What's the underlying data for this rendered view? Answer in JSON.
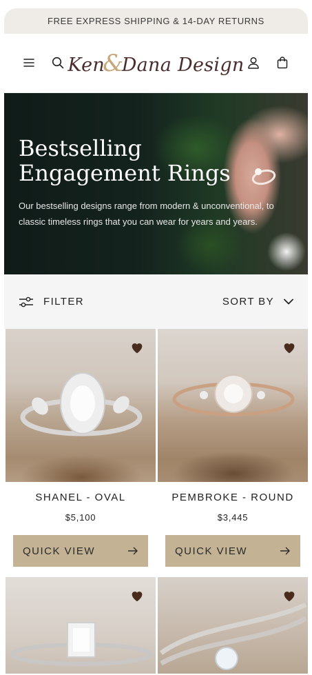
{
  "promo": {
    "text": "FREE EXPRESS SHIPPING & 14-DAY RETURNS"
  },
  "header": {
    "logo_part1": "Ken",
    "logo_amp": "&",
    "logo_part2": "Dana Design",
    "icons": [
      "menu-icon",
      "search-icon",
      "account-icon",
      "bag-icon"
    ]
  },
  "hero": {
    "title_line1": "Bestselling",
    "title_line2": "Engagement Rings",
    "description": "Our bestselling designs range from modern & unconventional, to classic timeless rings that you can wear for years and years."
  },
  "toolbar": {
    "filter_label": "FILTER",
    "sort_label": "SORT BY"
  },
  "products": [
    {
      "name": "SHANEL - OVAL",
      "price": "$5,100",
      "cta": "QUICK VIEW"
    },
    {
      "name": "PEMBROKE - ROUND",
      "price": "$3,445",
      "cta": "QUICK VIEW"
    },
    {
      "name": "",
      "price": "",
      "cta": ""
    },
    {
      "name": "",
      "price": "",
      "cta": ""
    }
  ],
  "colors": {
    "promo_bg": "#efebe6",
    "accent": "#c3b293",
    "heart": "#4a2c1e",
    "logo": "#4a2c2c",
    "logo_amp": "#c7a77b"
  }
}
